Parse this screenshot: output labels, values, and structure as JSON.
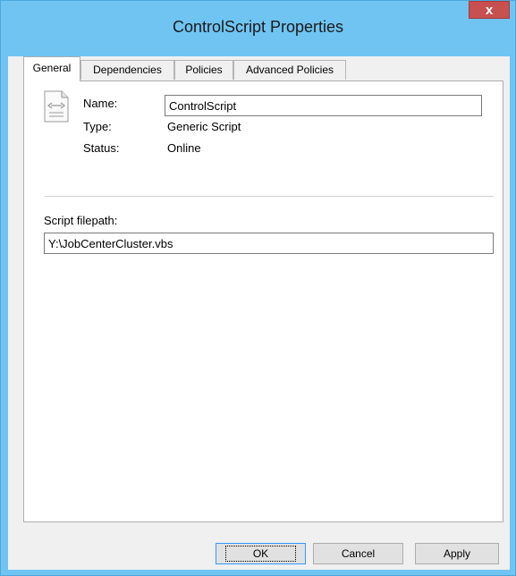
{
  "window": {
    "title": "ControlScript Properties",
    "close_glyph": "x"
  },
  "tabs": [
    {
      "label": "General",
      "active": true
    },
    {
      "label": "Dependencies",
      "active": false
    },
    {
      "label": "Policies",
      "active": false
    },
    {
      "label": "Advanced Policies",
      "active": false
    }
  ],
  "general": {
    "icon": "script-file-icon",
    "name_label": "Name:",
    "name_value": "ControlScript",
    "type_label": "Type:",
    "type_value": "Generic Script",
    "status_label": "Status:",
    "status_value": "Online",
    "filepath_label": "Script filepath:",
    "filepath_value": "Y:\\JobCenterCluster.vbs"
  },
  "buttons": {
    "ok": "OK",
    "cancel": "Cancel",
    "apply": "Apply"
  }
}
